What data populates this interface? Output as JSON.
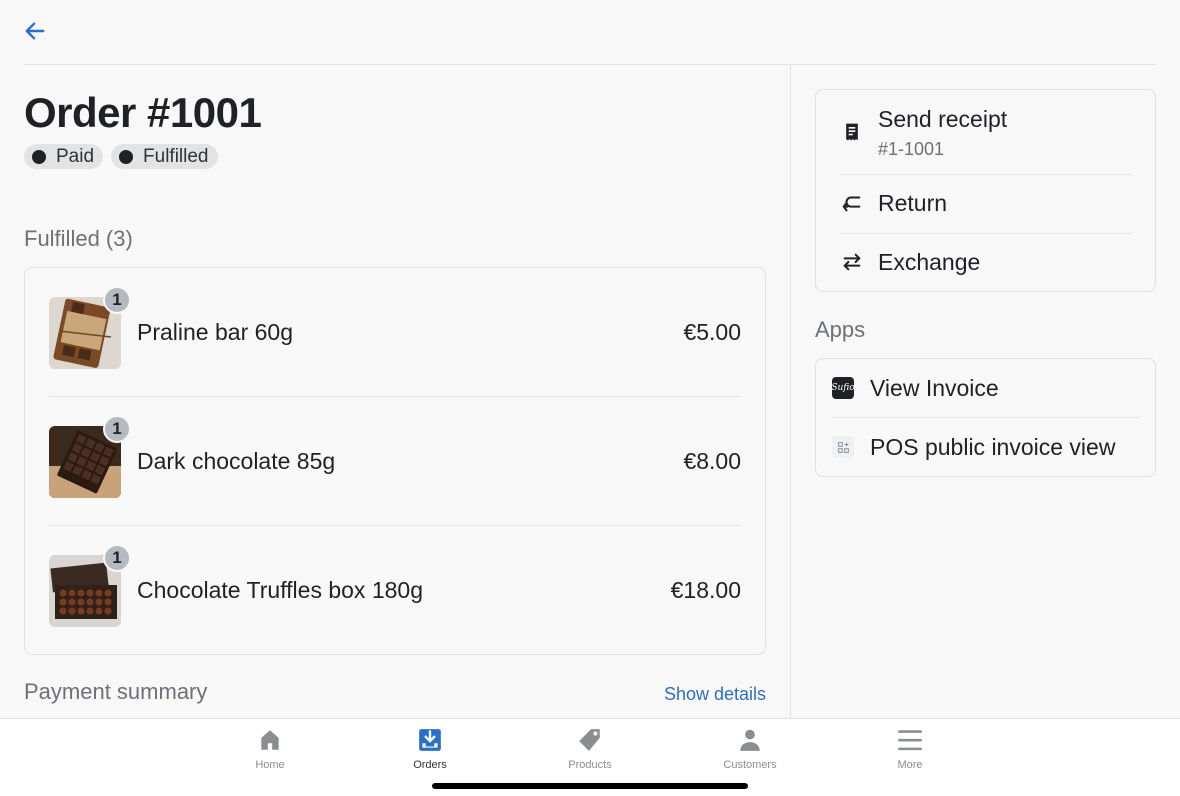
{
  "header": {
    "back_icon": "arrow-left-icon"
  },
  "order": {
    "title": "Order #1001",
    "badges": [
      {
        "label": "Paid"
      },
      {
        "label": "Fulfilled"
      }
    ]
  },
  "fulfilled": {
    "title": "Fulfilled (3)",
    "items": [
      {
        "name": "Praline bar 60g",
        "price": "€5.00",
        "qty": "1"
      },
      {
        "name": "Dark chocolate 85g",
        "price": "€8.00",
        "qty": "1"
      },
      {
        "name": "Chocolate Truffles box 180g",
        "price": "€18.00",
        "qty": "1"
      }
    ]
  },
  "payment": {
    "title": "Payment summary",
    "show_details": "Show details"
  },
  "actions": {
    "send_receipt": {
      "label": "Send receipt",
      "sub": "#1-1001",
      "icon": "receipt-icon"
    },
    "return": {
      "label": "Return",
      "icon": "return-arrow-icon"
    },
    "exchange": {
      "label": "Exchange",
      "icon": "exchange-arrows-icon"
    }
  },
  "apps": {
    "title": "Apps",
    "items": [
      {
        "label": "View Invoice",
        "icon": "sufio-app-icon"
      },
      {
        "label": "POS public invoice view",
        "icon": "app-grid-icon"
      }
    ]
  },
  "tabbar": {
    "accent": "#2c6ecb",
    "active": "Orders",
    "tabs": [
      {
        "label": "Home",
        "icon": "home-icon"
      },
      {
        "label": "Orders",
        "icon": "orders-icon"
      },
      {
        "label": "Products",
        "icon": "tag-icon"
      },
      {
        "label": "Customers",
        "icon": "person-icon"
      },
      {
        "label": "More",
        "icon": "menu-icon"
      }
    ]
  }
}
